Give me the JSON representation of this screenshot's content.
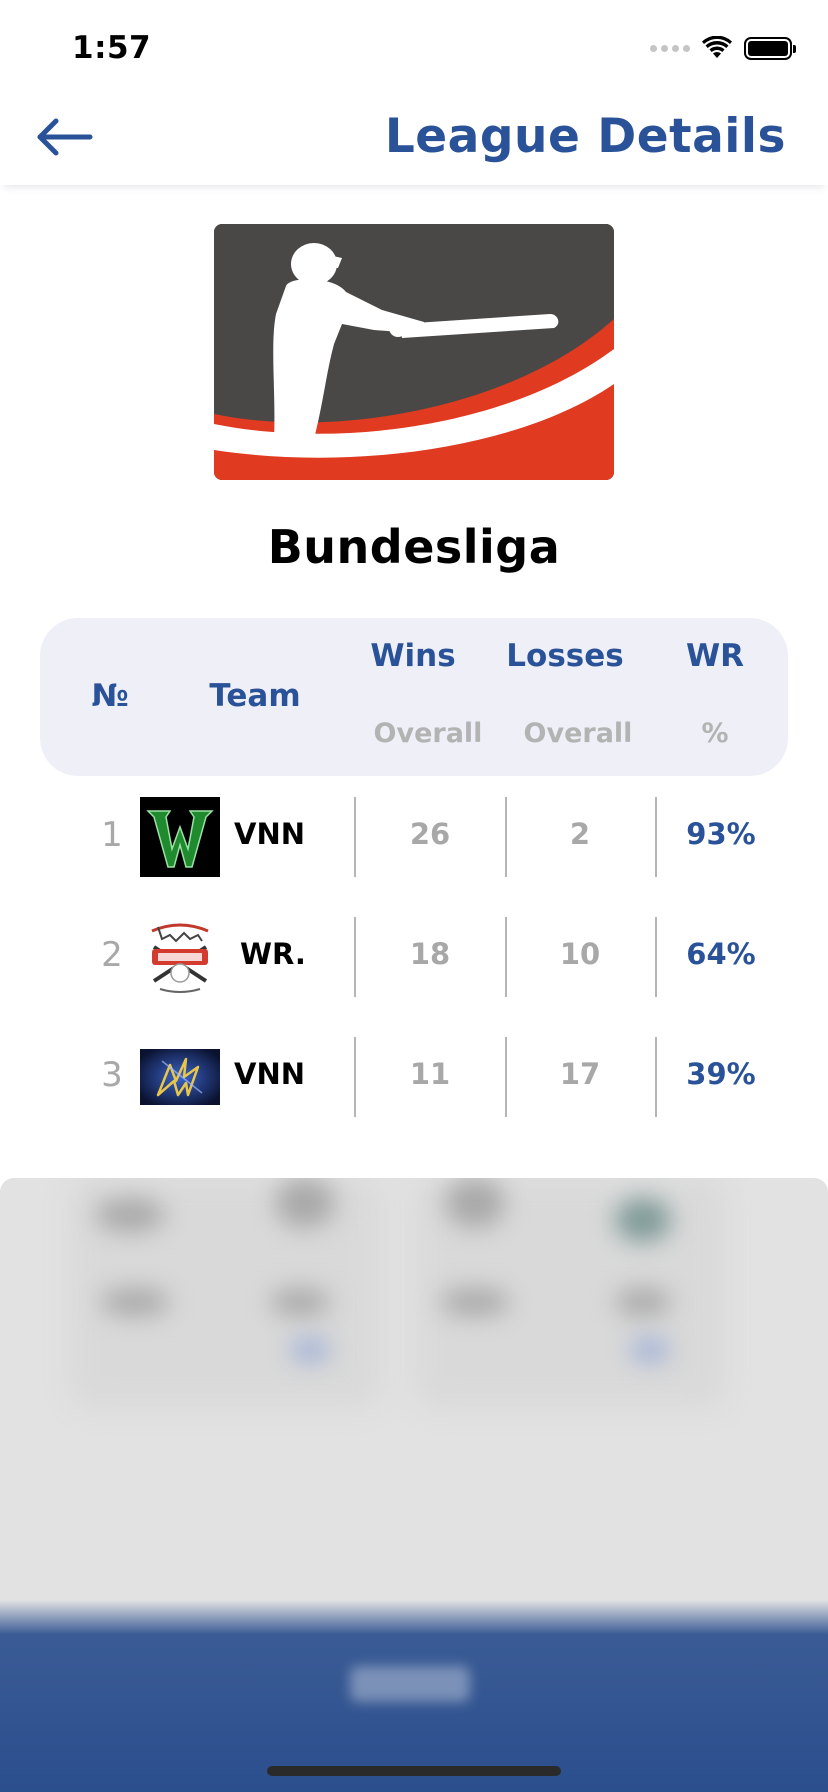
{
  "status_bar": {
    "time": "1:57"
  },
  "header": {
    "title": "League Details"
  },
  "league": {
    "name": "Bundesliga"
  },
  "table": {
    "columns": {
      "rank": "№",
      "team": "Team",
      "wins": "Wins",
      "wins_sub": "Overall",
      "losses": "Losses",
      "losses_sub": "Overall",
      "wr": "WR",
      "wr_sub": "%"
    },
    "rows": [
      {
        "rank": "1",
        "team": "VNN",
        "wins": "26",
        "losses": "2",
        "wr": "93%"
      },
      {
        "rank": "2",
        "team": "WR.",
        "wins": "18",
        "losses": "10",
        "wr": "64%"
      },
      {
        "rank": "3",
        "team": "VNN",
        "wins": "11",
        "losses": "17",
        "wr": "39%"
      }
    ]
  },
  "colors": {
    "accent": "#2a5298",
    "header_bg": "#eff0f7",
    "logo_red": "#e03a20",
    "logo_dark": "#4a4846"
  }
}
